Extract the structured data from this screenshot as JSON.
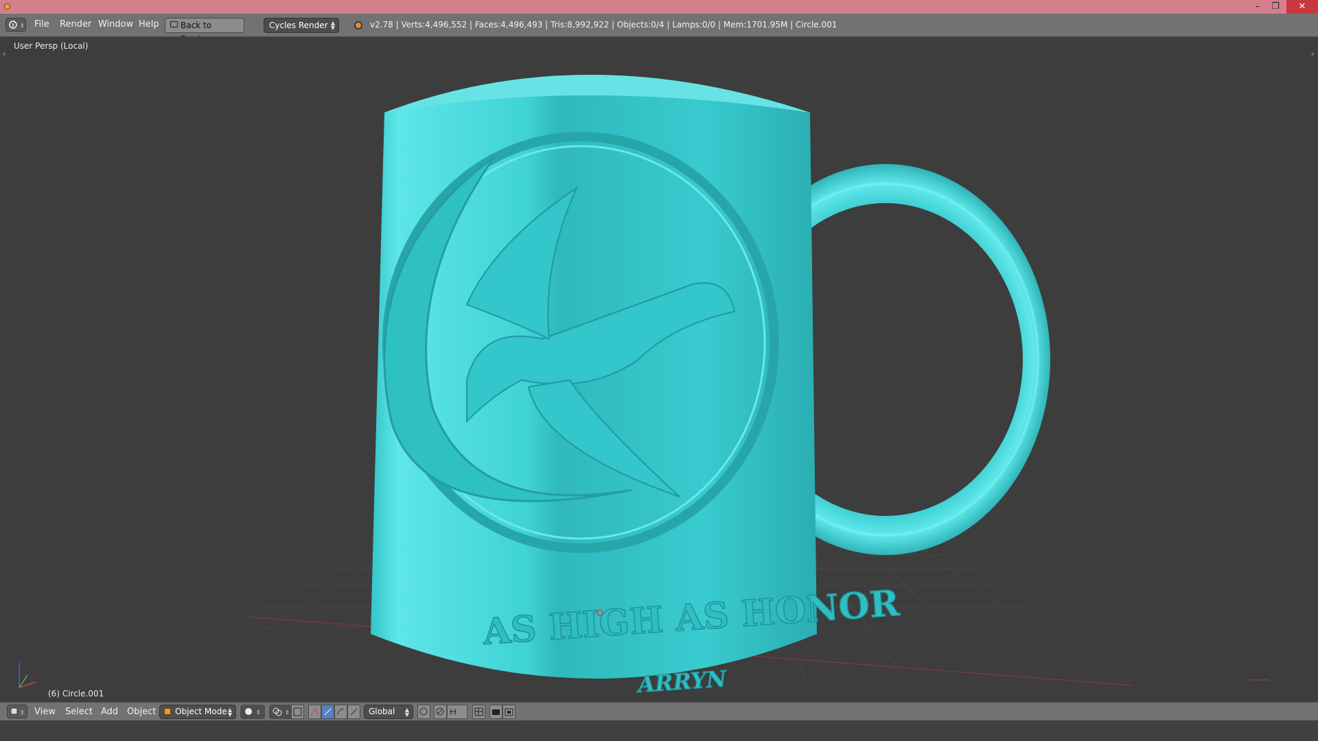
{
  "window": {
    "minimize": "–",
    "restore": "❐",
    "close": "✕"
  },
  "menubar": {
    "items": [
      "File",
      "Render",
      "Window",
      "Help"
    ],
    "back_label": "Back to Previous",
    "render_engine": "Cycles Render",
    "stats": "v2.78 | Verts:4,496,552 | Faces:4,496,493 | Tris:8,992,922 | Objects:0/4 | Lamps:0/0 | Mem:1701.95M | Circle.001"
  },
  "viewport": {
    "view_name": "User Persp (Local)",
    "active_object": "(6) Circle.001",
    "mug_text_main": "AS HIGH AS HONOR",
    "mug_text_sub": "ARRYN",
    "colors": {
      "mug": "#3fd3d6",
      "background": "#3d3d3d",
      "grid": "#4a4a4a"
    }
  },
  "bottombar": {
    "items": [
      "View",
      "Select",
      "Add",
      "Object"
    ],
    "mode": "Object Mode",
    "orientation": "Global"
  }
}
